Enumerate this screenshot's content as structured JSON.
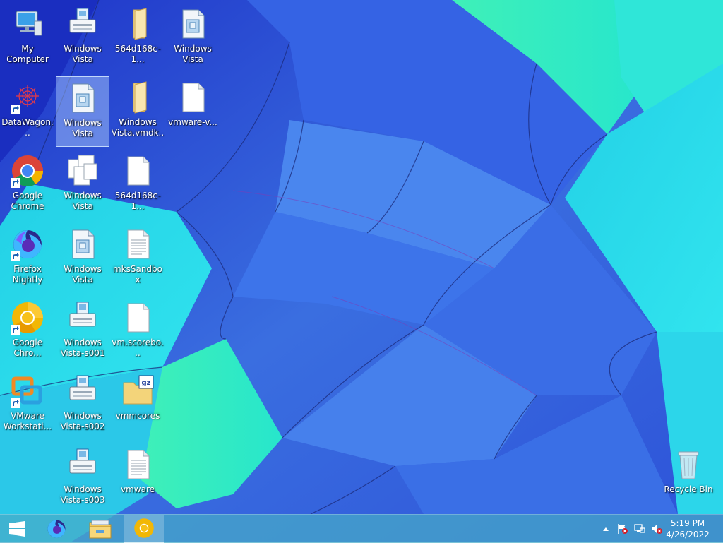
{
  "desktop": {
    "icons": [
      {
        "label": "My Computer",
        "icon": "computer-icon"
      },
      {
        "label": "Windows Vista",
        "icon": "vm-team-icon"
      },
      {
        "label": "564d168c-1...",
        "icon": "folder-icon"
      },
      {
        "label": "Windows Vista",
        "icon": "vm-file-icon"
      },
      {
        "label": "DataWagon...",
        "icon": "datawagon-icon"
      },
      {
        "label": "Windows Vista",
        "icon": "vm-file-icon"
      },
      {
        "label": "Windows Vista.vmdk....",
        "icon": "folder-icon"
      },
      {
        "label": "vmware-v...",
        "icon": "file-icon"
      },
      {
        "label": "Google Chrome",
        "icon": "chrome-icon"
      },
      {
        "label": "Windows Vista",
        "icon": "vmdk-icon"
      },
      {
        "label": "564d168c-1...",
        "icon": "file-icon"
      },
      {
        "label": "Firefox Nightly",
        "icon": "firefox-nightly-icon"
      },
      {
        "label": "Windows Vista",
        "icon": "vm-file-icon"
      },
      {
        "label": "mksSandbox",
        "icon": "text-file-icon"
      },
      {
        "label": "Google Chro...",
        "icon": "chrome-canary-icon"
      },
      {
        "label": "Windows Vista-s001",
        "icon": "vm-team-icon"
      },
      {
        "label": "vm.scorebo...",
        "icon": "file-icon"
      },
      {
        "label": "VMware Workstati...",
        "icon": "vmware-workstation-icon"
      },
      {
        "label": "Windows Vista-s002",
        "icon": "vm-team-icon"
      },
      {
        "label": "vmmcores",
        "icon": "gz-archive-icon"
      },
      {
        "label": "Windows Vista-s003",
        "icon": "vm-team-icon"
      },
      {
        "label": "vmware",
        "icon": "text-file-icon"
      },
      {
        "label": "Recycle Bin",
        "icon": "recycle-bin-icon"
      }
    ]
  },
  "taskbar": {
    "start": "start-icon",
    "pinned": [
      "firefox-nightly-icon",
      "file-explorer-icon",
      "chrome-canary-icon"
    ],
    "tray": [
      "show-hidden-icons-chevron",
      "action-center-flag-icon",
      "network-icon",
      "volume-muted-icon"
    ],
    "clock": {
      "time": "5:19 PM",
      "date": "4/26/2022"
    }
  },
  "colors": {
    "taskbar": "#46aac8",
    "wallpaper_blue": "#3e7fe8",
    "wallpaper_cyan": "#2ee0e8"
  }
}
